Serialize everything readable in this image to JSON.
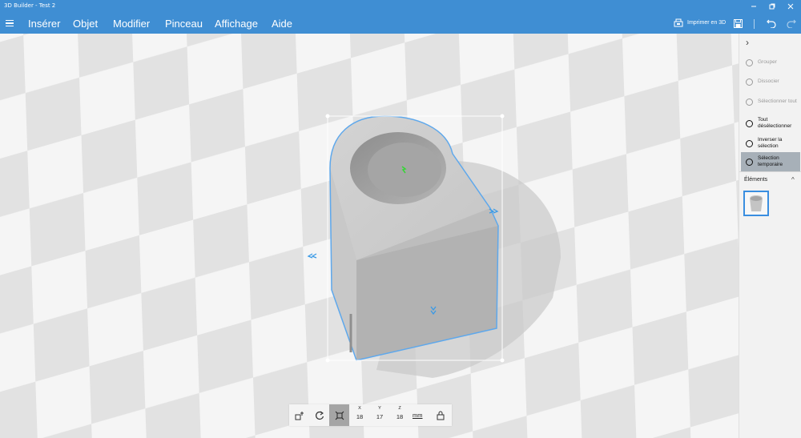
{
  "window": {
    "title": "3D Builder - Test 2"
  },
  "menu": {
    "items": [
      "Insérer",
      "Objet",
      "Modifier",
      "Pinceau",
      "Affichage",
      "Aide"
    ]
  },
  "toolbar": {
    "print_label": "Imprimer en 3D"
  },
  "panel": {
    "items": [
      {
        "label": "Grouper",
        "state": "disabled",
        "icon": "group-icon"
      },
      {
        "label": "Dissocier",
        "state": "disabled",
        "icon": "ungroup-icon"
      },
      {
        "label": "Sélectionner tout",
        "state": "disabled",
        "icon": "select-all-icon"
      },
      {
        "label": "Tout désélectionner",
        "state": "enabled",
        "icon": "deselect-all-icon"
      },
      {
        "label": "Inverser la sélection",
        "state": "enabled",
        "icon": "invert-selection-icon"
      },
      {
        "label": "Sélection temporaire",
        "state": "active",
        "icon": "temporary-selection-icon"
      }
    ],
    "elements_heading": "Éléments"
  },
  "dimensions": {
    "x_label": "X",
    "x_value": "18",
    "y_label": "Y",
    "y_value": "17",
    "z_label": "Z",
    "z_value": "18",
    "unit": "mm"
  },
  "colors": {
    "accent": "#3f8ed3",
    "selection": "#4aa3ea",
    "active_panel": "#a7b0b8"
  }
}
